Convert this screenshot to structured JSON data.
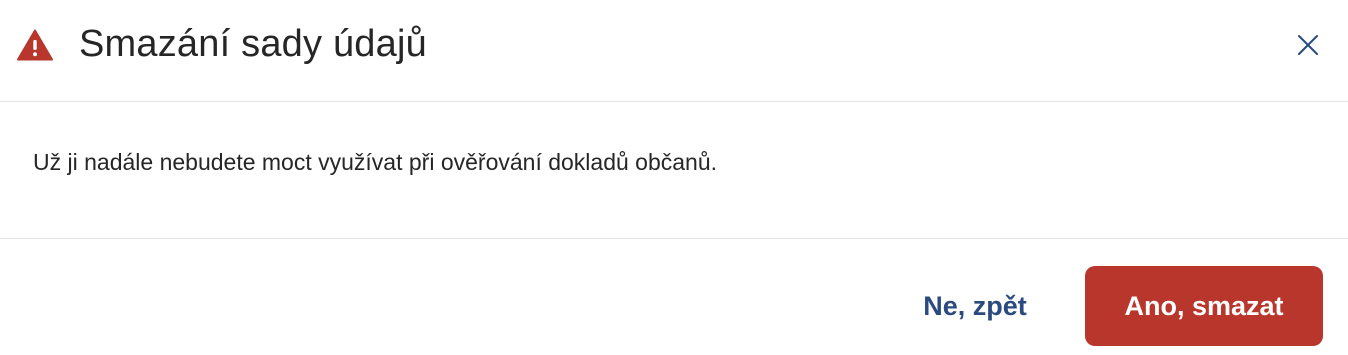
{
  "dialog": {
    "title": "Smazání sady údajů",
    "title_icon": "warning-triangle-icon",
    "close_icon": "close-icon",
    "message": "Už ji nadále nebudete moct využívat při ověřování dokladů občanů.",
    "secondary_button_label": "Ne, zpět",
    "primary_button_label": "Ano, smazat"
  },
  "colors": {
    "warning": "#b8362b",
    "primary_button": "#b8362b",
    "secondary_text": "#2b4a7f",
    "title_text": "#262626",
    "divider": "#e3e3e3",
    "close_icon": "#2b4a7f"
  }
}
